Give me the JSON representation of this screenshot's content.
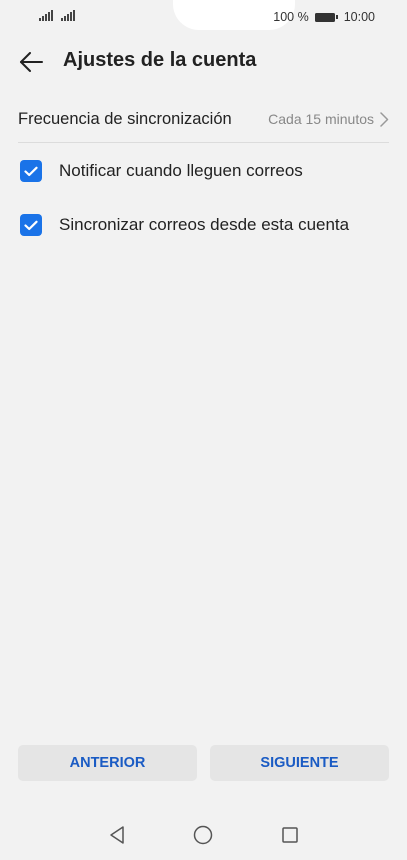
{
  "status_bar": {
    "battery_text": "100 %",
    "time": "10:00"
  },
  "header": {
    "back_icon": "arrow-left-icon",
    "title": "Ajustes de la cuenta"
  },
  "settings": {
    "sync_frequency": {
      "label": "Frecuencia de sincronización",
      "value": "Cada 15 minutos",
      "icon": "chevron-right-icon"
    },
    "options": [
      {
        "label": "Notificar cuando lleguen correos",
        "checked": true
      },
      {
        "label": "Sincronizar correos desde esta cuenta",
        "checked": true
      }
    ]
  },
  "buttons": {
    "previous": "ANTERIOR",
    "next": "SIGUIENTE"
  },
  "nav_bar": {
    "back_icon": "triangle-back-icon",
    "home_icon": "circle-home-icon",
    "recents_icon": "square-recents-icon"
  },
  "colors": {
    "accent": "#1a73e8",
    "button_text": "#1a5bc4",
    "background": "#f2f2f2"
  }
}
